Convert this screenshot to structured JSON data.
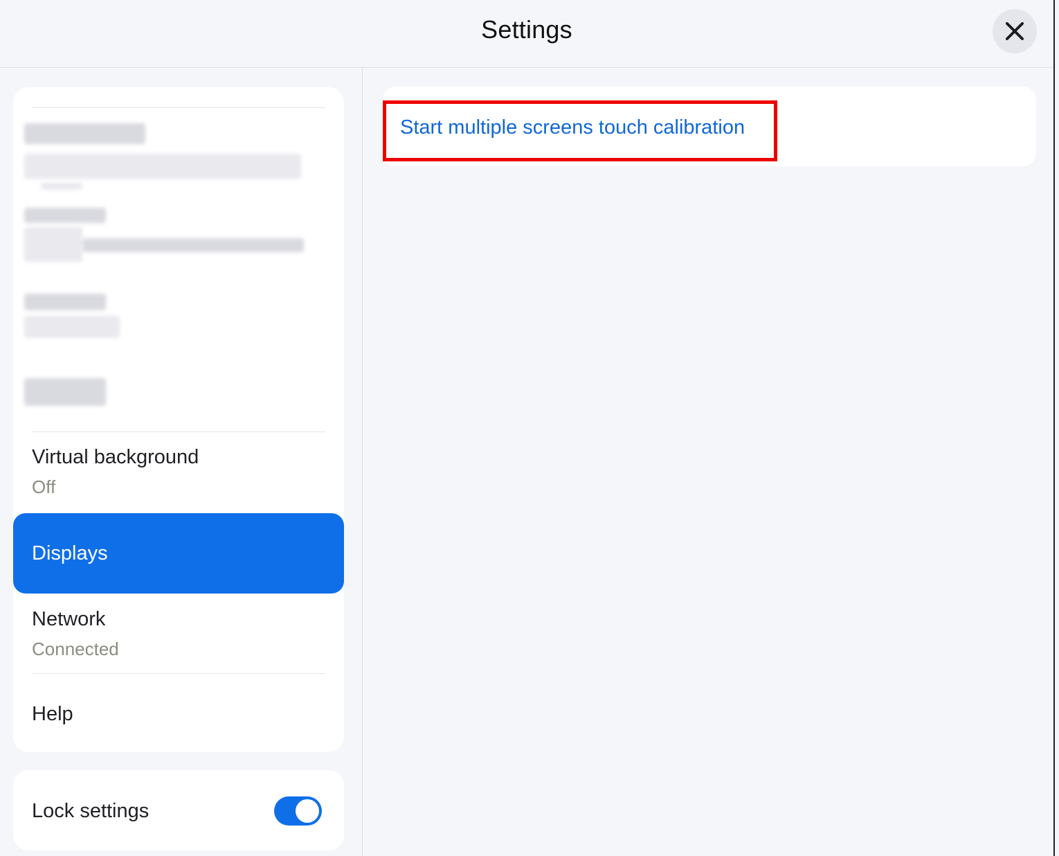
{
  "header": {
    "title": "Settings",
    "close_icon": "close-icon"
  },
  "sidebar": {
    "items": [
      {
        "label": "Virtual background",
        "sub": "Off",
        "active": false
      },
      {
        "label": "Displays",
        "sub": "",
        "active": true
      },
      {
        "label": "Network",
        "sub": "Connected",
        "active": false
      },
      {
        "label": "Help",
        "sub": "",
        "active": false
      }
    ],
    "lock": {
      "label": "Lock settings",
      "enabled": true
    }
  },
  "content": {
    "calibration_link": "Start multiple screens touch calibration"
  },
  "colors": {
    "accent": "#0f6fe9",
    "link": "#1167d6",
    "highlight": "#ee0000",
    "background": "#f5f6fa"
  }
}
